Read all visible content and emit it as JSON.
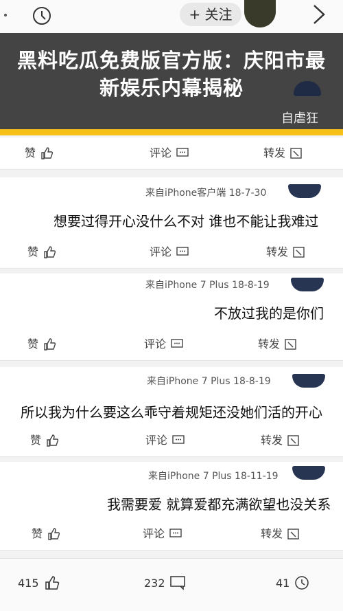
{
  "header": {
    "follow_label": "+ 关注"
  },
  "banner": {
    "title": "黑料吃瓜免费版官方版：庆阳市最新娱乐内幕揭秘",
    "username": "自虐狂"
  },
  "action_labels": {
    "repost": "转发",
    "comment": "评论",
    "like": "赞"
  },
  "posts": [
    {
      "date": "18-7-30",
      "source": "来自iPhone客户端",
      "text": "想要过得开心没什么不对 谁也不能让我难过"
    },
    {
      "date": "18-8-19",
      "source": "来自iPhone 7 Plus",
      "text": "不放过我的是你们"
    },
    {
      "date": "18-8-19",
      "source": "来自iPhone 7 Plus",
      "text": "所以我为什么要这么乖守着规矩还没她们活的开心"
    },
    {
      "date": "18-11-19",
      "source": "来自iPhone 7 Plus",
      "text": "我需要爱 就算爱都充满欲望也没关系"
    }
  ],
  "bottom_bar": {
    "repost_count": "41",
    "comment_count": "232",
    "like_count": "415"
  },
  "colors": {
    "accent": "#f6c21a",
    "banner_bg": "#3c3c3c"
  }
}
